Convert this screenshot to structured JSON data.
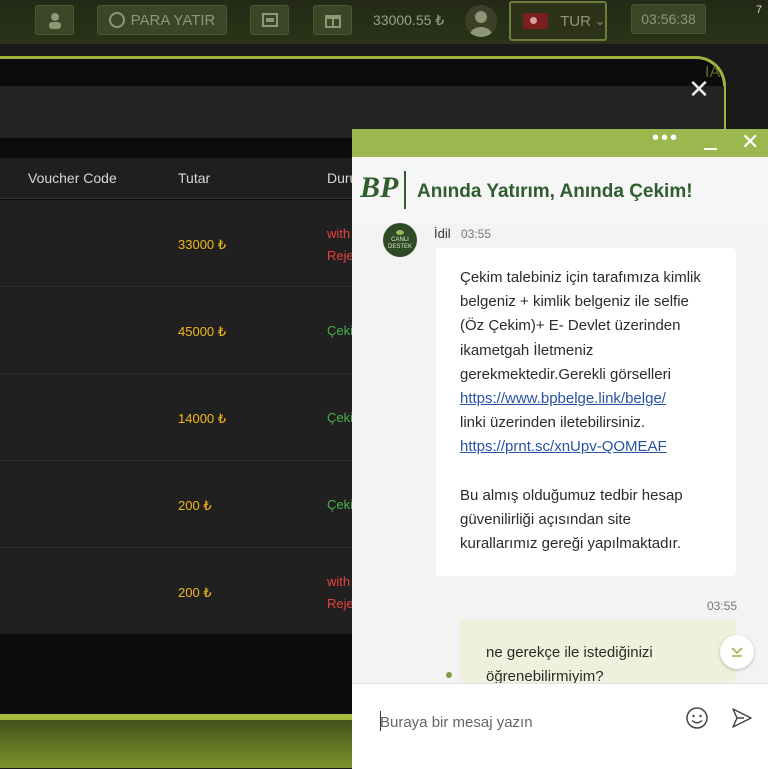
{
  "header": {
    "deposit_label": "PARA YATIR",
    "balance": "33000.55 ₺",
    "language": "TUR",
    "clock": "03:56:38",
    "notification_count": "7"
  },
  "background_tab": "IA",
  "table": {
    "columns": [
      "Voucher Code",
      "Tutar",
      "Duru"
    ],
    "rows": [
      {
        "amount": "33000 ₺",
        "status_line1": "with",
        "status_line2": "Reje",
        "status_color": "red"
      },
      {
        "amount": "45000 ₺",
        "status_line1": "Çeki",
        "status_line2": "",
        "status_color": "green"
      },
      {
        "amount": "14000 ₺",
        "status_line1": "Çeki",
        "status_line2": "",
        "status_color": "green"
      },
      {
        "amount": "200 ₺",
        "status_line1": "Çeki",
        "status_line2": "",
        "status_color": "green"
      },
      {
        "amount": "200 ₺",
        "status_line1": "with",
        "status_line2": "Reje",
        "status_color": "red"
      }
    ]
  },
  "chat": {
    "header_dots": "•••",
    "brand_logo": "BP",
    "brand_slogan": "Anında Yatırım, Anında Çekim!",
    "agent": {
      "avatar_line1": "CANLI",
      "avatar_line2": "DESTEK",
      "name": "İdil",
      "time": "03:55"
    },
    "incoming": {
      "part1": "Çekim talebiniz için tarafımıza kimlik belgeniz + kimlik belgeniz ile selfie (Öz Çekim)+ E- Devlet üzerinden ikametgah İletmeniz gerekmektedir.Gerekli görselleri",
      "link1": "https://www.bpbelge.link/belge/",
      "part2": "linki üzerinden iletebilirsiniz.",
      "link2": "https://prnt.sc/xnUpv-QOMEAF",
      "part3": "Bu almış olduğumuz tedbir hesap güvenilirliği açısından site kurallarımız gereği yapılmaktadır."
    },
    "outgoing": {
      "time": "03:55",
      "text": "ne gerekçe ile istediğinizi öğrenebilirmiyim?"
    },
    "input_placeholder": "Buraya bir mesaj yazın"
  },
  "colors": {
    "accent": "#9bb84f",
    "amount": "#f1b81d",
    "success": "#47b14d",
    "rejected": "#e84040",
    "brand": "#2f5d2e"
  }
}
